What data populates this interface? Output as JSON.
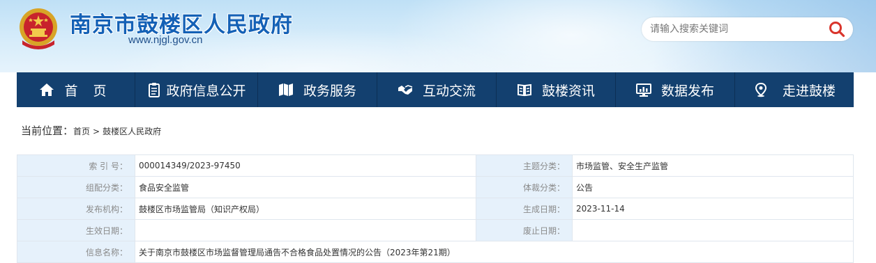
{
  "header": {
    "title": "南京市鼓楼区人民政府",
    "url": "www.njgl.gov.cn",
    "emblem_icon": "national-emblem-icon",
    "colors": {
      "title": "#1461b6",
      "nav_bg": "#13406f",
      "label_bg": "#e6f1fb"
    }
  },
  "search": {
    "placeholder": "请输入搜索关键词",
    "value": "",
    "icon": "search-icon",
    "icon_color": "#d9342b"
  },
  "nav": {
    "items": [
      {
        "label": "首 页",
        "icon": "home-icon"
      },
      {
        "label": "政府信息公开",
        "icon": "clipboard-icon"
      },
      {
        "label": "政务服务",
        "icon": "map-icon"
      },
      {
        "label": "互动交流",
        "icon": "handshake-icon"
      },
      {
        "label": "鼓楼资讯",
        "icon": "book-icon"
      },
      {
        "label": "数据发布",
        "icon": "monitor-icon"
      },
      {
        "label": "走进鼓楼",
        "icon": "location-pin-icon"
      }
    ]
  },
  "breadcrumb": {
    "prefix": "当前位置：",
    "items": [
      "首页",
      "鼓楼区人民政府"
    ],
    "separator": ">"
  },
  "meta": {
    "rows": [
      {
        "k1": "索 引 号：",
        "v1": "000014349/2023-97450",
        "k2": "主题分类：",
        "v2": "市场监管、安全生产监管"
      },
      {
        "k1": "组配分类：",
        "v1": "食品安全监管",
        "k2": "体裁分类：",
        "v2": "公告"
      },
      {
        "k1": "发布机构：",
        "v1": "鼓楼区市场监管局（知识产权局）",
        "k2": "生成日期：",
        "v2": "2023-11-14"
      },
      {
        "k1": "生效日期：",
        "v1": "",
        "k2": "废止日期：",
        "v2": ""
      }
    ],
    "info_name_label": "信息名称：",
    "info_name_value": "关于南京市鼓楼区市场监督管理局通告不合格食品处置情况的公告（2023年第21期）"
  }
}
